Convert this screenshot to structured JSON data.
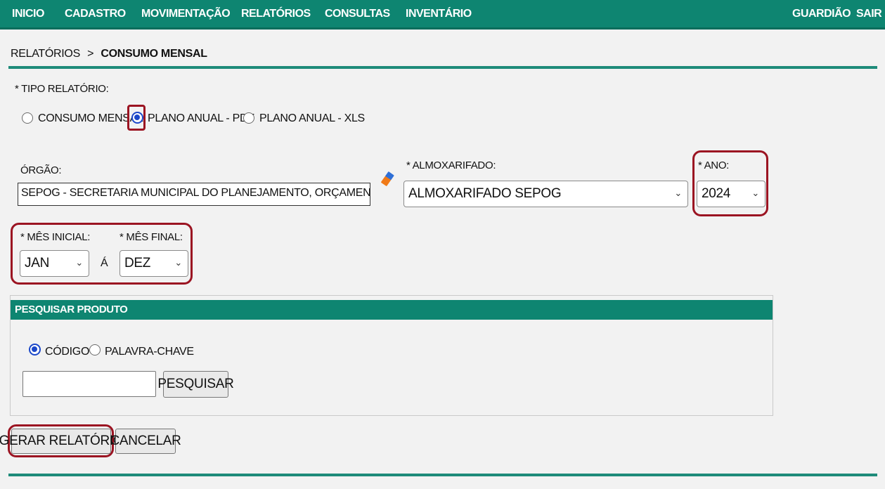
{
  "nav": {
    "items": [
      "INICIO",
      "CADASTRO",
      "MOVIMENTAÇÃO",
      "RELATÓRIOS",
      "CONSULTAS",
      "INVENTÁRIO"
    ],
    "right": [
      "GUARDIÃO",
      "SAIR"
    ]
  },
  "breadcrumb": {
    "parent": "RELATÓRIOS",
    "separator": ">",
    "current": "CONSUMO MENSAL"
  },
  "report_type": {
    "label": "* TIPO RELATÓRIO:",
    "options": [
      "CONSUMO MENSAL",
      "PLANO ANUAL - PDF",
      "PLANO ANUAL - XLS"
    ],
    "selected": "PLANO ANUAL - PDF"
  },
  "orgao": {
    "label": "ÓRGÃO:",
    "value": "SEPOG - SECRETARIA MUNICIPAL DO PLANEJAMENTO, ORÇAMENTO E GESTÃO"
  },
  "almoxarifado": {
    "label": "* ALMOXARIFADO:",
    "value": "ALMOXARIFADO SEPOG"
  },
  "ano": {
    "label": "* ANO:",
    "value": "2024"
  },
  "mes_inicial": {
    "label": "* MÊS INICIAL:",
    "value": "JAN"
  },
  "range_sep": "Á",
  "mes_final": {
    "label": "* MÊS FINAL:",
    "value": "DEZ"
  },
  "search": {
    "title": "PESQUISAR PRODUTO",
    "options": [
      "CÓDIGO",
      "PALAVRA-CHAVE"
    ],
    "selected": "CÓDIGO",
    "input_value": "",
    "button_label": "PESQUISAR"
  },
  "actions": {
    "generate": "GERAR RELATÓRIO",
    "cancel": "CANCELAR"
  },
  "colors": {
    "nav_bg": "#0e8571",
    "rule": "#1e8b7a",
    "highlight": "#9b1422",
    "radio_selected": "#1c48c9"
  }
}
